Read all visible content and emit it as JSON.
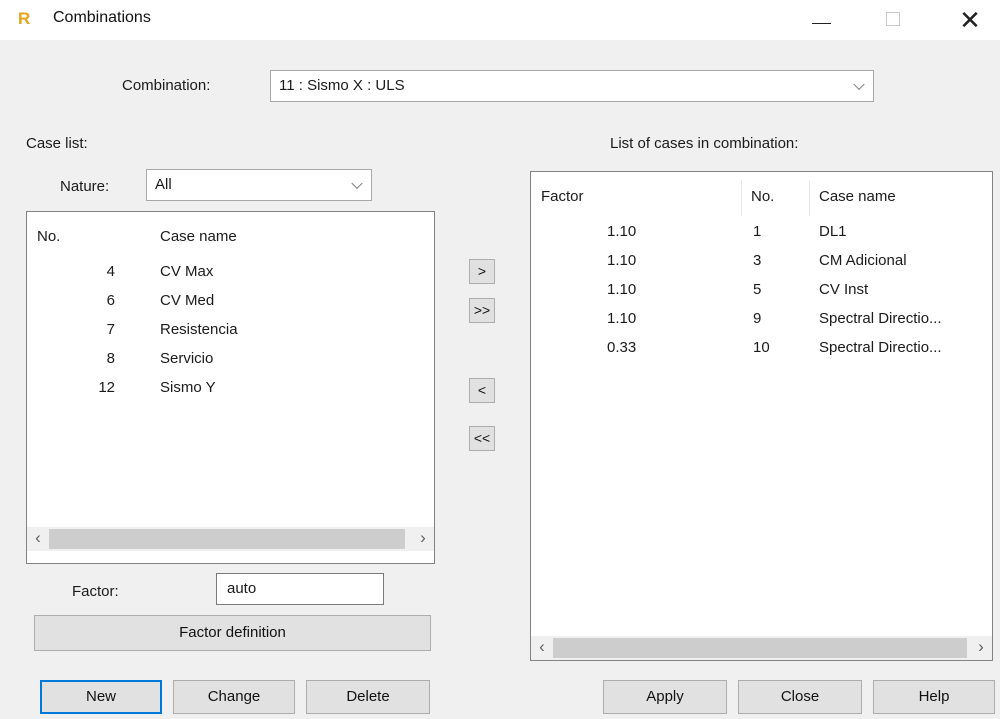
{
  "window": {
    "app_icon": "R",
    "title": "Combinations",
    "minimize_icon": "minimize-icon",
    "maximize_icon": "maximize-icon",
    "close_glyph": "✕"
  },
  "combination": {
    "label": "Combination:",
    "value": "11 : Sismo X : ULS"
  },
  "case_list": {
    "label": "Case list:",
    "nature_label": "Nature:",
    "nature_value": "All",
    "headers": {
      "no": "No.",
      "name": "Case name"
    },
    "rows": [
      {
        "no": "4",
        "name": "CV Max"
      },
      {
        "no": "6",
        "name": "CV Med"
      },
      {
        "no": "7",
        "name": "Resistencia"
      },
      {
        "no": "8",
        "name": "Servicio"
      },
      {
        "no": "12",
        "name": "Sismo Y"
      }
    ],
    "scroll_left": "‹",
    "scroll_right": "›"
  },
  "transfer": {
    "add": ">",
    "add_all": ">>",
    "remove": "<",
    "remove_all": "<<"
  },
  "factor": {
    "label": "Factor:",
    "value": "auto",
    "definition_button": "Factor definition"
  },
  "combination_list": {
    "label": "List of cases in combination:",
    "headers": {
      "factor": "Factor",
      "no": "No.",
      "name": "Case name"
    },
    "rows": [
      {
        "factor": "1.10",
        "no": "1",
        "name": "DL1"
      },
      {
        "factor": "1.10",
        "no": "3",
        "name": "CM Adicional"
      },
      {
        "factor": "1.10",
        "no": "5",
        "name": "CV Inst"
      },
      {
        "factor": "1.10",
        "no": "9",
        "name": "Spectral Directio..."
      },
      {
        "factor": "0.33",
        "no": "10",
        "name": "Spectral Directio..."
      }
    ],
    "scroll_left": "‹",
    "scroll_right": "›"
  },
  "buttons": {
    "new": "New",
    "change": "Change",
    "delete": "Delete",
    "apply": "Apply",
    "close": "Close",
    "help": "Help"
  },
  "colors": {
    "accent": "#0078d7",
    "app_icon": "#e8a317",
    "dialog_bg": "#f0f0f0"
  }
}
